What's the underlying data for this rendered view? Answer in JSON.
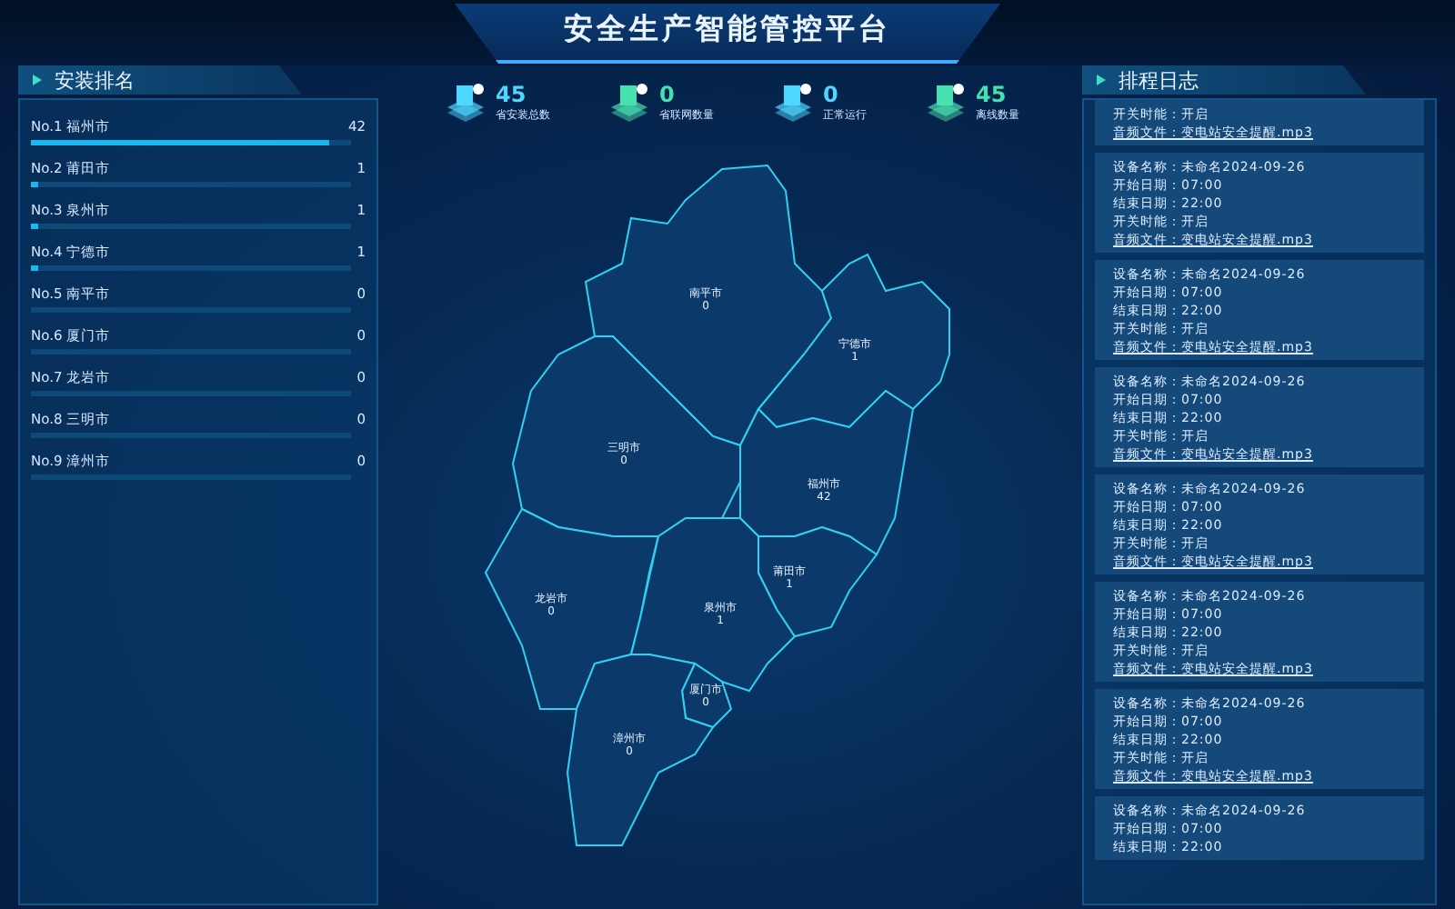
{
  "header": {
    "title": "安全生产智能管控平台"
  },
  "ranking": {
    "title": "安装排名",
    "items": [
      {
        "rank": "No.1",
        "city": "福州市",
        "value": "42",
        "level": 0.93
      },
      {
        "rank": "No.2",
        "city": "莆田市",
        "value": "1",
        "level": 0.022
      },
      {
        "rank": "No.3",
        "city": "泉州市",
        "value": "1",
        "level": 0.022
      },
      {
        "rank": "No.4",
        "city": "宁德市",
        "value": "1",
        "level": 0.022
      },
      {
        "rank": "No.5",
        "city": "南平市",
        "value": "0",
        "level": 0
      },
      {
        "rank": "No.6",
        "city": "厦门市",
        "value": "0",
        "level": 0
      },
      {
        "rank": "No.7",
        "city": "龙岩市",
        "value": "0",
        "level": 0
      },
      {
        "rank": "No.8",
        "city": "三明市",
        "value": "0",
        "level": 0
      },
      {
        "rank": "No.9",
        "city": "漳州市",
        "value": "0",
        "level": 0
      }
    ]
  },
  "stats": [
    {
      "value": "45",
      "label": "省安装总数",
      "color": "#4fd6ff"
    },
    {
      "value": "0",
      "label": "省联网数量",
      "color": "#49e0b0"
    },
    {
      "value": "0",
      "label": "正常运行",
      "color": "#4fd6ff"
    },
    {
      "value": "45",
      "label": "离线数量",
      "color": "#49e0b0"
    }
  ],
  "map": {
    "regions": [
      {
        "name": "南平市",
        "value": "0"
      },
      {
        "name": "宁德市",
        "value": "1"
      },
      {
        "name": "三明市",
        "value": "0"
      },
      {
        "name": "福州市",
        "value": "42"
      },
      {
        "name": "龙岩市",
        "value": "0"
      },
      {
        "name": "泉州市",
        "value": "1"
      },
      {
        "name": "莆田市",
        "value": "1"
      },
      {
        "name": "厦门市",
        "value": "0"
      },
      {
        "name": "漳州市",
        "value": "0"
      }
    ]
  },
  "log": {
    "title": "排程日志",
    "entries": [
      {
        "fields": [
          {
            "label": "开关时能：",
            "value": "开启",
            "kind": "text"
          },
          {
            "label": "音频文件：",
            "value": "变电站安全提醒.mp3",
            "kind": "link"
          }
        ]
      },
      {
        "fields": [
          {
            "label": "设备名称：",
            "value": "未命名2024-09-26",
            "kind": "text"
          },
          {
            "label": "开始日期：",
            "value": "07:00",
            "kind": "text"
          },
          {
            "label": "结束日期：",
            "value": "22:00",
            "kind": "text"
          },
          {
            "label": "开关时能：",
            "value": "开启",
            "kind": "text"
          },
          {
            "label": "音频文件：",
            "value": "变电站安全提醒.mp3",
            "kind": "link"
          }
        ]
      },
      {
        "fields": [
          {
            "label": "设备名称：",
            "value": "未命名2024-09-26",
            "kind": "text"
          },
          {
            "label": "开始日期：",
            "value": "07:00",
            "kind": "text"
          },
          {
            "label": "结束日期：",
            "value": "22:00",
            "kind": "text"
          },
          {
            "label": "开关时能：",
            "value": "开启",
            "kind": "text"
          },
          {
            "label": "音频文件：",
            "value": "变电站安全提醒.mp3",
            "kind": "link"
          }
        ]
      },
      {
        "fields": [
          {
            "label": "设备名称：",
            "value": "未命名2024-09-26",
            "kind": "text"
          },
          {
            "label": "开始日期：",
            "value": "07:00",
            "kind": "text"
          },
          {
            "label": "结束日期：",
            "value": "22:00",
            "kind": "text"
          },
          {
            "label": "开关时能：",
            "value": "开启",
            "kind": "text"
          },
          {
            "label": "音频文件：",
            "value": "变电站安全提醒.mp3",
            "kind": "link"
          }
        ]
      },
      {
        "fields": [
          {
            "label": "设备名称：",
            "value": "未命名2024-09-26",
            "kind": "text"
          },
          {
            "label": "开始日期：",
            "value": "07:00",
            "kind": "text"
          },
          {
            "label": "结束日期：",
            "value": "22:00",
            "kind": "text"
          },
          {
            "label": "开关时能：",
            "value": "开启",
            "kind": "text"
          },
          {
            "label": "音频文件：",
            "value": "变电站安全提醒.mp3",
            "kind": "link"
          }
        ]
      },
      {
        "fields": [
          {
            "label": "设备名称：",
            "value": "未命名2024-09-26",
            "kind": "text"
          },
          {
            "label": "开始日期：",
            "value": "07:00",
            "kind": "text"
          },
          {
            "label": "结束日期：",
            "value": "22:00",
            "kind": "text"
          },
          {
            "label": "开关时能：",
            "value": "开启",
            "kind": "text"
          },
          {
            "label": "音频文件：",
            "value": "变电站安全提醒.mp3",
            "kind": "link"
          }
        ]
      },
      {
        "fields": [
          {
            "label": "设备名称：",
            "value": "未命名2024-09-26",
            "kind": "text"
          },
          {
            "label": "开始日期：",
            "value": "07:00",
            "kind": "text"
          },
          {
            "label": "结束日期：",
            "value": "22:00",
            "kind": "text"
          },
          {
            "label": "开关时能：",
            "value": "开启",
            "kind": "text"
          },
          {
            "label": "音频文件：",
            "value": "变电站安全提醒.mp3",
            "kind": "link"
          }
        ]
      },
      {
        "fields": [
          {
            "label": "设备名称：",
            "value": "未命名2024-09-26",
            "kind": "text"
          },
          {
            "label": "开始日期：",
            "value": "07:00",
            "kind": "text"
          },
          {
            "label": "结束日期：",
            "value": "22:00",
            "kind": "text"
          }
        ]
      }
    ]
  }
}
